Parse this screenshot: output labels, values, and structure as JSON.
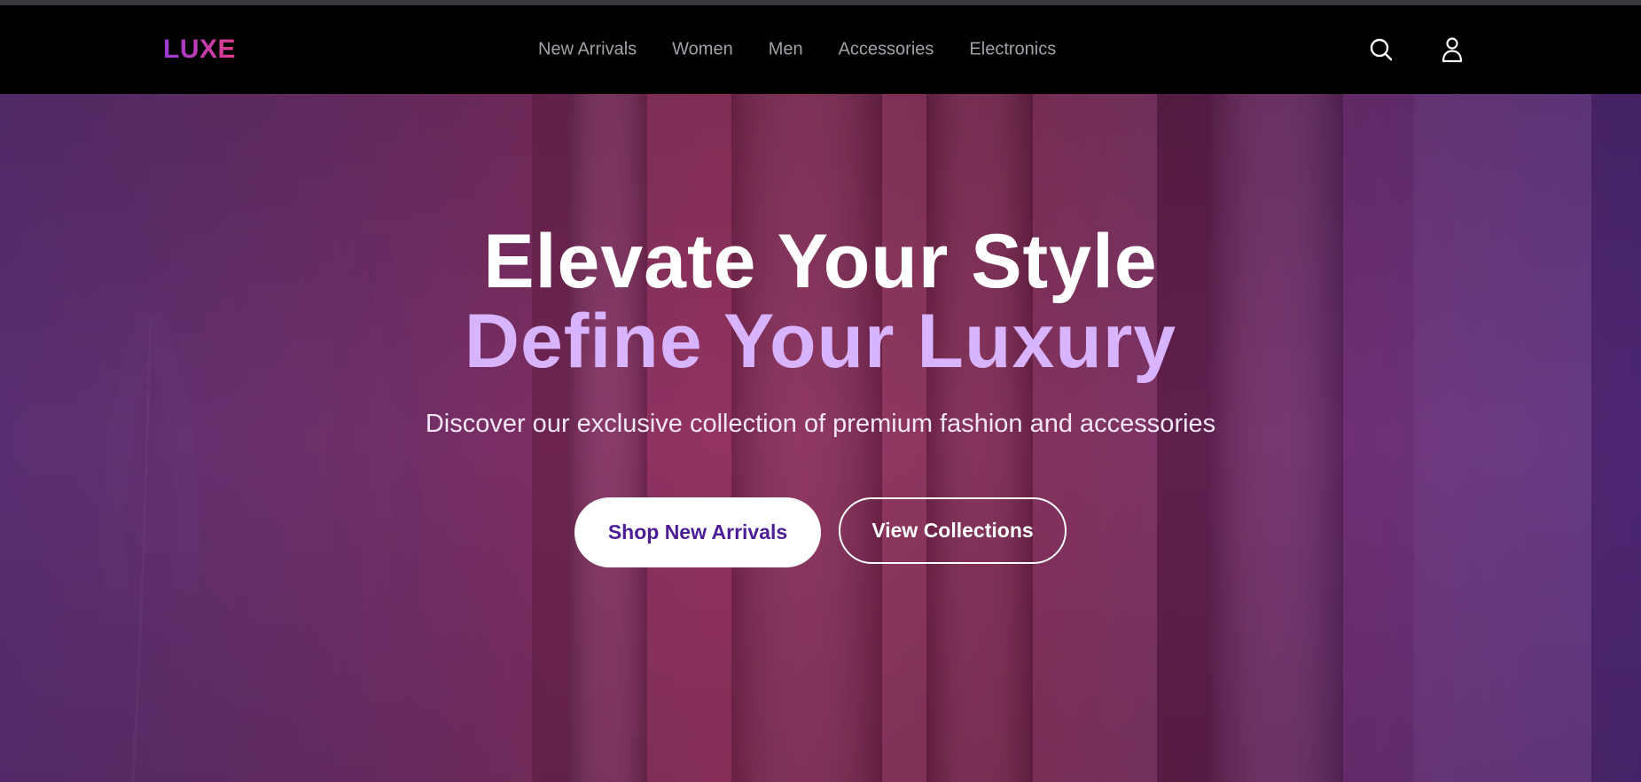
{
  "brand": {
    "logo_text": "LUXE",
    "gradient_start": "#9b3ad6",
    "gradient_end": "#e23d8e"
  },
  "nav": {
    "links": [
      {
        "label": "New Arrivals"
      },
      {
        "label": "Women"
      },
      {
        "label": "Men"
      },
      {
        "label": "Accessories"
      },
      {
        "label": "Electronics"
      }
    ],
    "icons": [
      "search-icon",
      "user-icon"
    ]
  },
  "hero": {
    "headline_line1": "Elevate Your Style",
    "headline_line2": "Define Your Luxury",
    "subtitle": "Discover our exclusive collection of premium fashion and accessories",
    "primary_cta": "Shop New Arrivals",
    "secondary_cta": "View Collections",
    "accent_color": "#d8b4fe",
    "primary_cta_text_color": "#4c1d95"
  }
}
